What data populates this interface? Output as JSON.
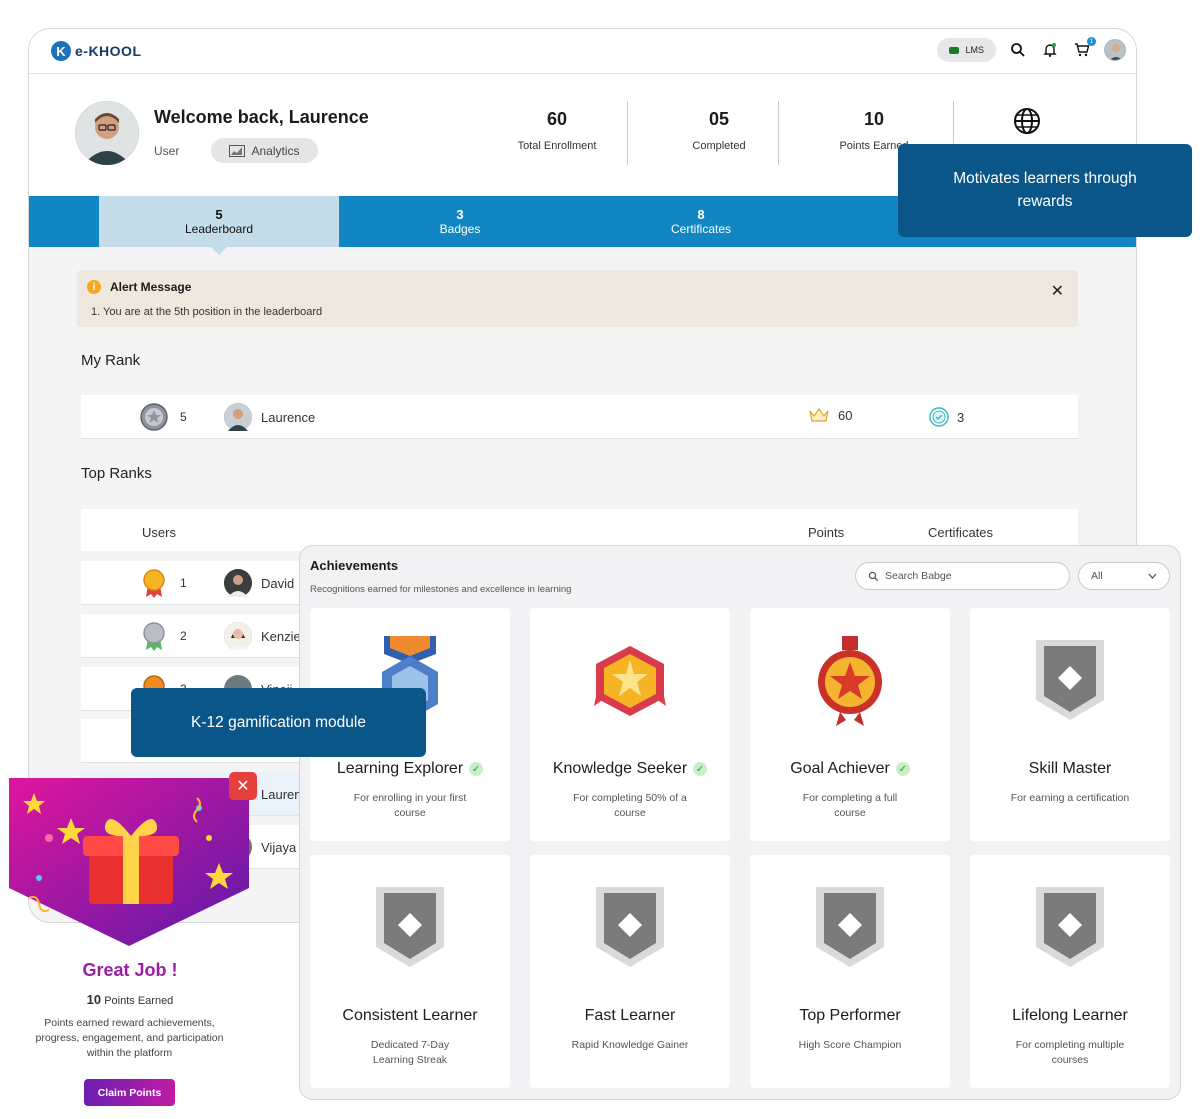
{
  "app": {
    "logo_text": "e-KHOOL",
    "logo_letter": "K"
  },
  "topbar": {
    "lms_label": "LMS",
    "cart_count": "1"
  },
  "profile": {
    "welcome": "Welcome back, Laurence",
    "role": "User",
    "analytics_label": "Analytics",
    "stats": [
      {
        "value": "60",
        "label": "Total Enrollment"
      },
      {
        "value": "05",
        "label": "Completed"
      },
      {
        "value": "10",
        "label": "Points Earned"
      }
    ]
  },
  "tabs": [
    {
      "count": "5",
      "label": "Leaderboard"
    },
    {
      "count": "3",
      "label": "Badges"
    },
    {
      "count": "8",
      "label": "Certificates"
    }
  ],
  "alert": {
    "title": "Alert Message",
    "message": "1. You are at the 5th position in the leaderboard"
  },
  "my_rank": {
    "title": "My Rank",
    "position": "5",
    "name": "Laurence",
    "points": "60",
    "certificates": "3"
  },
  "top_ranks": {
    "title": "Top Ranks",
    "headers": {
      "users": "Users",
      "points": "Points",
      "certificates": "Certificates"
    },
    "rows": [
      {
        "position": "1",
        "name": "David"
      },
      {
        "position": "2",
        "name": "Kenzie"
      },
      {
        "position": "3",
        "name": "Vinoji"
      },
      {
        "position": "",
        "name": "Laurence"
      },
      {
        "position": "",
        "name": "Vijaya"
      }
    ]
  },
  "callouts": {
    "rewards": "Motivates learners through rewards",
    "gamification": "K-12 gamification module"
  },
  "achievements": {
    "title": "Achievements",
    "subtitle": "Recognitions earned for milestones and excellence in learning",
    "search_placeholder": "Search Babge",
    "filter_value": "All",
    "cards": [
      {
        "name": "Learning Explorer",
        "desc": "For enrolling in your first course",
        "earned": true
      },
      {
        "name": "Knowledge Seeker",
        "desc": "For completing 50% of a course",
        "earned": true
      },
      {
        "name": "Goal Achiever",
        "desc": "For completing a full course",
        "earned": true
      },
      {
        "name": "Skill Master",
        "desc": "For earning a certification",
        "earned": false
      },
      {
        "name": "Consistent Learner",
        "desc": "Dedicated 7-Day Learning Streak",
        "earned": false
      },
      {
        "name": "Fast Learner",
        "desc": "Rapid Knowledge Gainer",
        "earned": false
      },
      {
        "name": "Top Performer",
        "desc": "High Score Champion",
        "earned": false
      },
      {
        "name": "Lifelong Learner",
        "desc": "For completing multiple courses",
        "earned": false
      }
    ]
  },
  "reward": {
    "title": "Great Job !",
    "points": "10",
    "points_label": "Points Earned",
    "description": "Points earned reward achievements, progress, engagement, and participation within the platform",
    "button": "Claim Points"
  },
  "colors": {
    "primary": "#1186c2",
    "callout": "#0b5689",
    "accent": "#9b1fa6"
  }
}
